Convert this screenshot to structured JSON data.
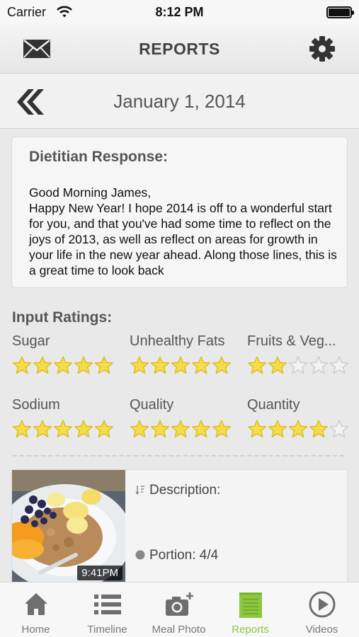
{
  "status_bar": {
    "carrier": "Carrier",
    "time": "8:12 PM"
  },
  "header": {
    "title": "REPORTS",
    "left_icon": "mail-icon",
    "right_icon": "gear-icon"
  },
  "date_bar": {
    "date": "January 1, 2014",
    "back_icon": "double-chevron-left-icon"
  },
  "dietitian": {
    "heading": "Dietitian Response:",
    "message": "Good Morning James,\nHappy New Year!  I hope 2014 is off to a wonderful start for you, and that you've had some time to reflect on the joys of 2013, as well as reflect on areas for growth in your life in the new year ahead.  Along those lines, this is a great time to look back"
  },
  "ratings": {
    "title": "Input Ratings:",
    "items": [
      {
        "label": "Sugar",
        "stars": 5
      },
      {
        "label": "Unhealthy Fats",
        "stars": 5
      },
      {
        "label": "Fruits & Veg...",
        "stars": 2
      },
      {
        "label": "Sodium",
        "stars": 5
      },
      {
        "label": "Quality",
        "stars": 5
      },
      {
        "label": "Quantity",
        "stars": 4
      }
    ],
    "max_stars": 5,
    "star_color": "#f5dd4a",
    "empty_star_color": "#f2f2f2"
  },
  "meal": {
    "time": "9:41PM",
    "description_label": "Description:",
    "portion_label": "Portion: 4/4"
  },
  "tab_bar": {
    "active_color": "#8dc63f",
    "tabs": [
      {
        "label": "Home",
        "icon": "home-icon"
      },
      {
        "label": "Timeline",
        "icon": "list-icon"
      },
      {
        "label": "Meal Photo",
        "icon": "camera-plus-icon"
      },
      {
        "label": "Reports",
        "icon": "report-icon",
        "active": true
      },
      {
        "label": "Videos",
        "icon": "play-icon"
      }
    ]
  }
}
